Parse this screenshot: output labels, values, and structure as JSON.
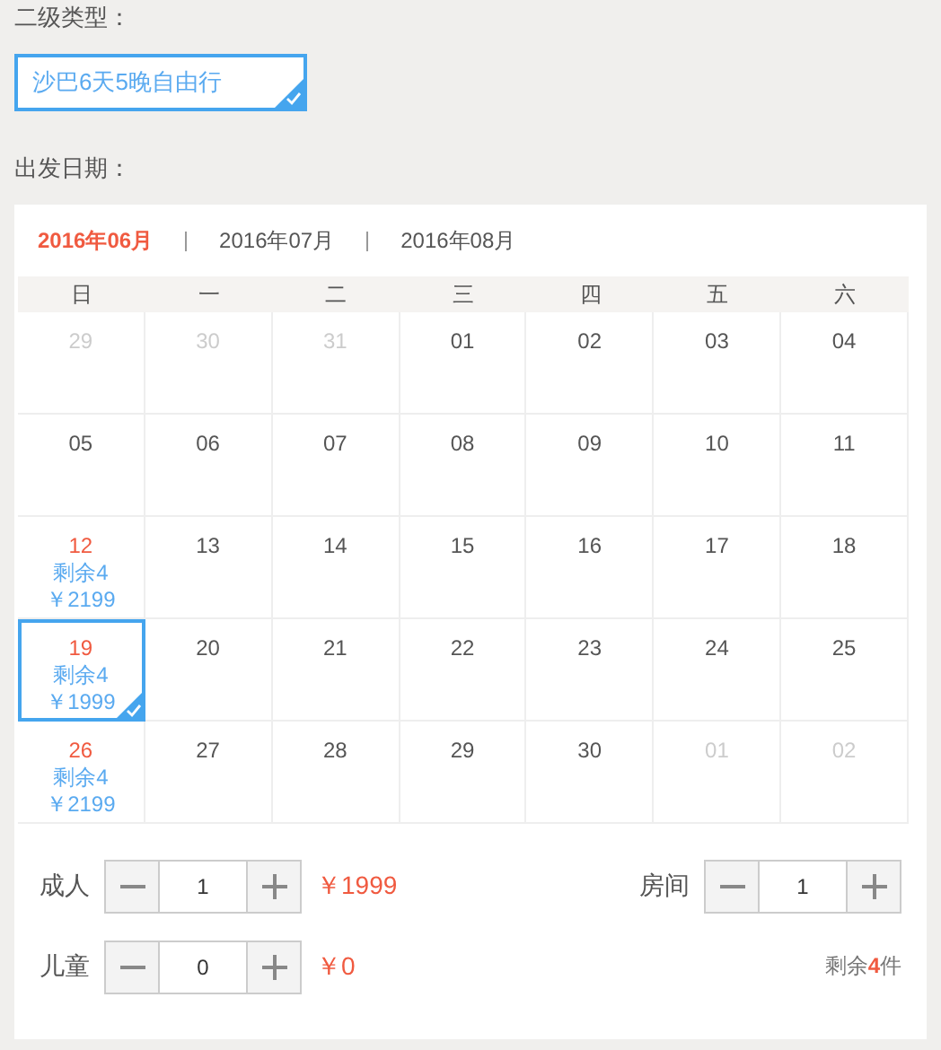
{
  "subtype": {
    "label": "二级类型：",
    "option": {
      "text": "沙巴6天5晚自由行",
      "selected": true
    }
  },
  "departure": {
    "label": "出发日期：",
    "months": [
      {
        "label": "2016年06月",
        "selected": true
      },
      {
        "label": "2016年07月",
        "selected": false
      },
      {
        "label": "2016年08月",
        "selected": false
      }
    ],
    "weekdays": [
      "日",
      "一",
      "二",
      "三",
      "四",
      "五",
      "六"
    ],
    "days": [
      {
        "day": "29",
        "kind": "other"
      },
      {
        "day": "30",
        "kind": "other"
      },
      {
        "day": "31",
        "kind": "other"
      },
      {
        "day": "01",
        "kind": "normal"
      },
      {
        "day": "02",
        "kind": "normal"
      },
      {
        "day": "03",
        "kind": "normal"
      },
      {
        "day": "04",
        "kind": "normal"
      },
      {
        "day": "05",
        "kind": "normal"
      },
      {
        "day": "06",
        "kind": "normal"
      },
      {
        "day": "07",
        "kind": "normal"
      },
      {
        "day": "08",
        "kind": "normal"
      },
      {
        "day": "09",
        "kind": "normal"
      },
      {
        "day": "10",
        "kind": "normal"
      },
      {
        "day": "11",
        "kind": "normal"
      },
      {
        "day": "12",
        "kind": "available",
        "stock": "剩余4",
        "price": "￥2199",
        "selected": false
      },
      {
        "day": "13",
        "kind": "normal"
      },
      {
        "day": "14",
        "kind": "normal"
      },
      {
        "day": "15",
        "kind": "normal"
      },
      {
        "day": "16",
        "kind": "normal"
      },
      {
        "day": "17",
        "kind": "normal"
      },
      {
        "day": "18",
        "kind": "normal"
      },
      {
        "day": "19",
        "kind": "available",
        "stock": "剩余4",
        "price": "￥1999",
        "selected": true
      },
      {
        "day": "20",
        "kind": "normal"
      },
      {
        "day": "21",
        "kind": "normal"
      },
      {
        "day": "22",
        "kind": "normal"
      },
      {
        "day": "23",
        "kind": "normal"
      },
      {
        "day": "24",
        "kind": "normal"
      },
      {
        "day": "25",
        "kind": "normal"
      },
      {
        "day": "26",
        "kind": "available",
        "stock": "剩余4",
        "price": "￥2199",
        "selected": false
      },
      {
        "day": "27",
        "kind": "normal"
      },
      {
        "day": "28",
        "kind": "normal"
      },
      {
        "day": "29",
        "kind": "normal"
      },
      {
        "day": "30",
        "kind": "normal"
      },
      {
        "day": "01",
        "kind": "other"
      },
      {
        "day": "02",
        "kind": "other"
      }
    ]
  },
  "quantities": {
    "adults": {
      "label": "成人",
      "value": "1",
      "price": "￥1999"
    },
    "rooms": {
      "label": "房间",
      "value": "1"
    },
    "children": {
      "label": "儿童",
      "value": "0",
      "price": "￥0"
    },
    "remaining": "剩余**4**件"
  }
}
